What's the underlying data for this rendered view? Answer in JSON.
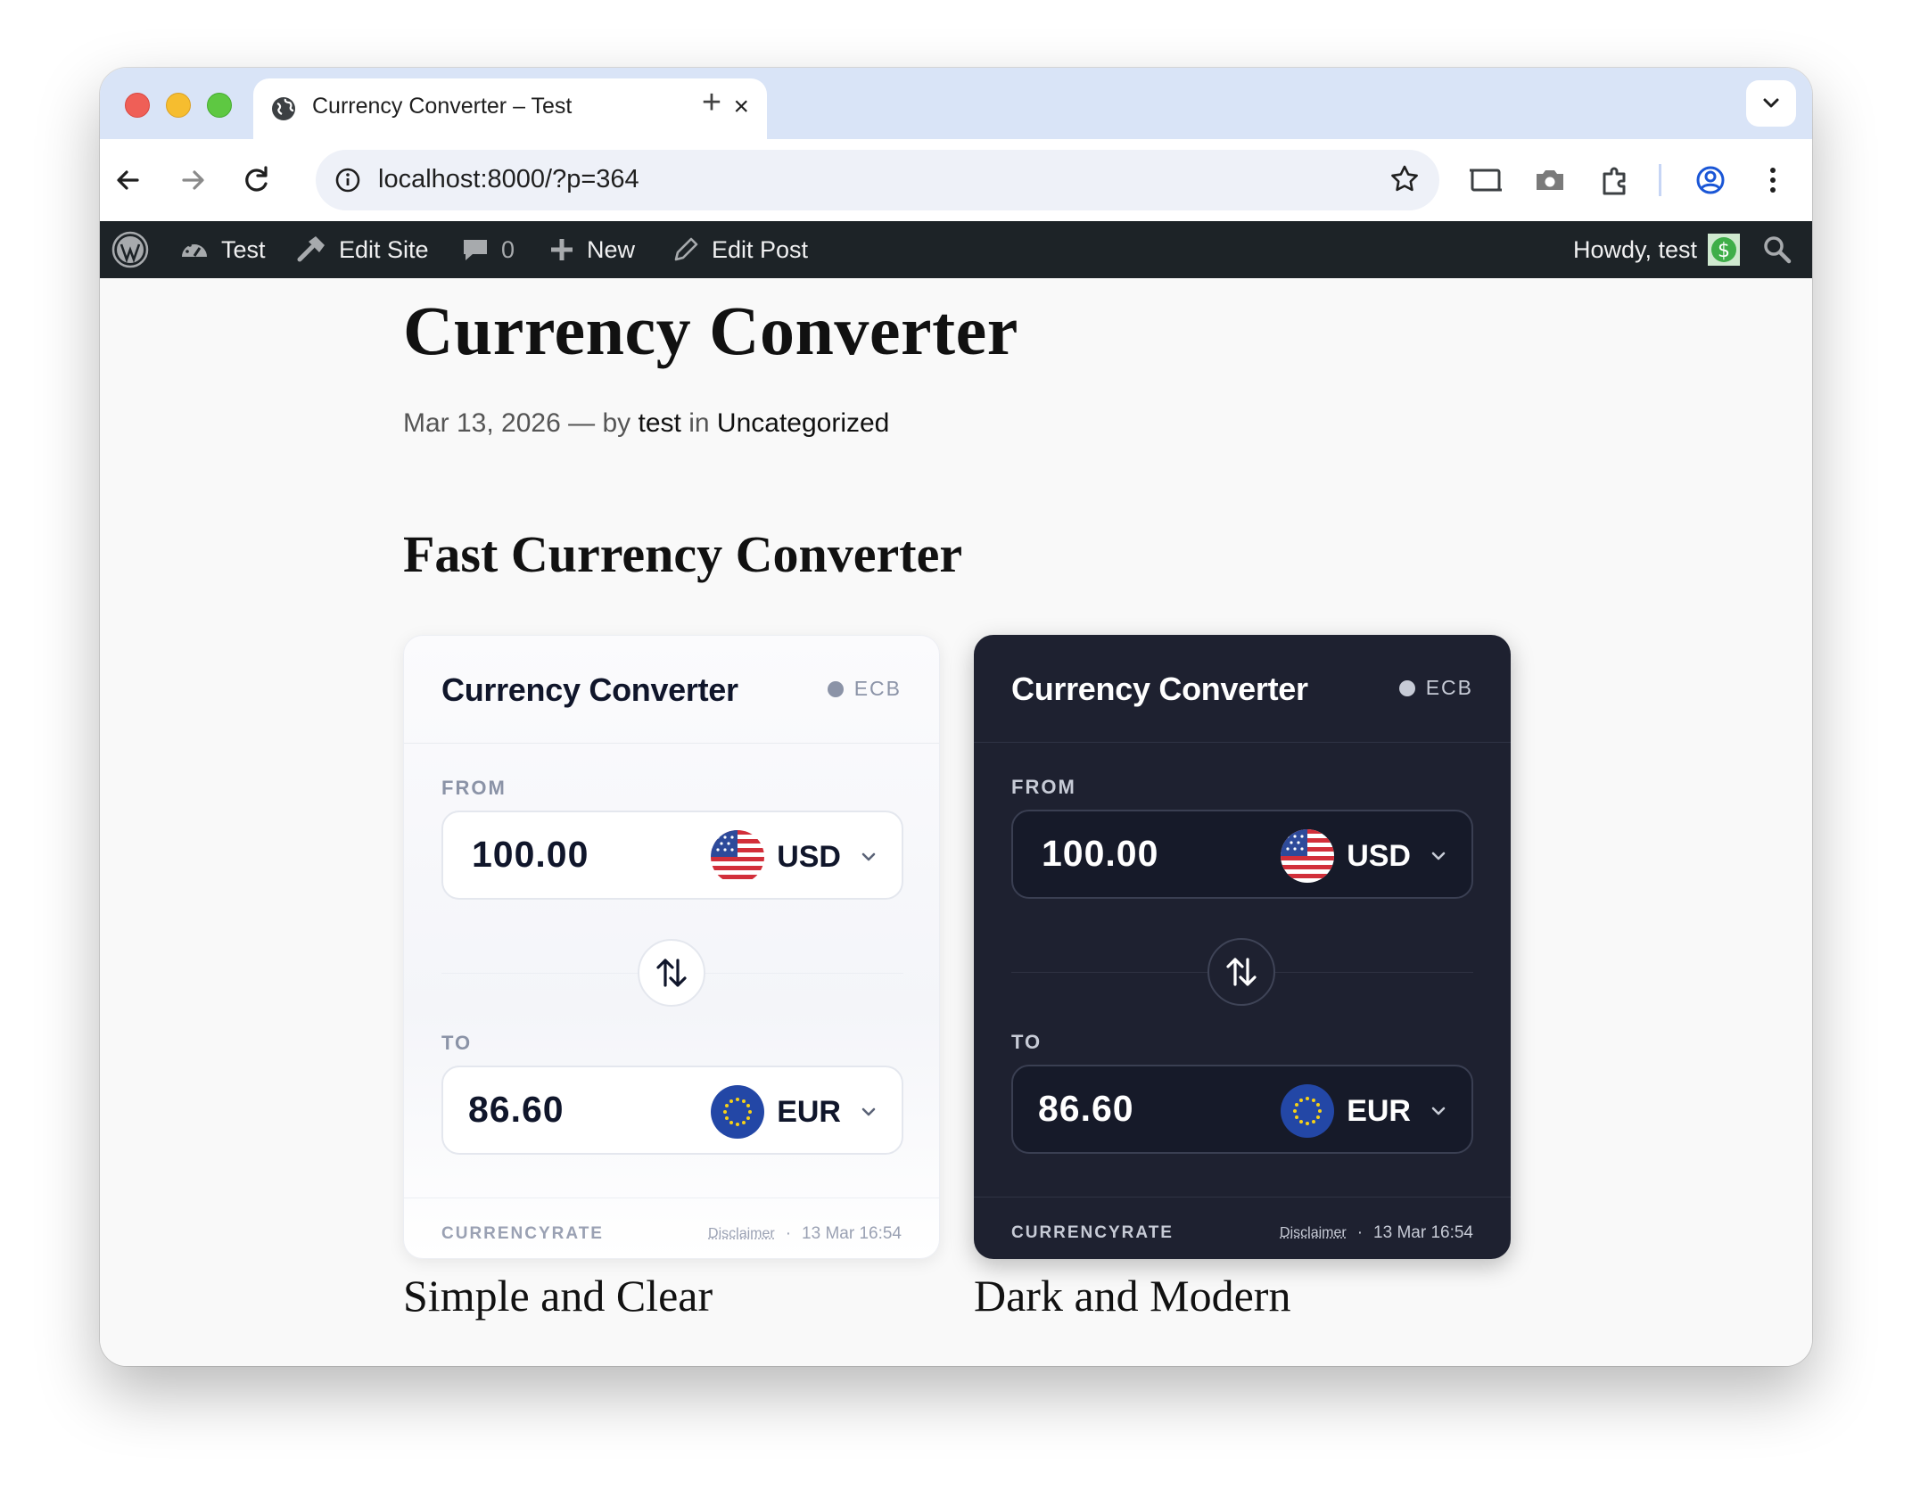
{
  "browser": {
    "tab_title": "Currency Converter – Test",
    "tab_close": "×",
    "new_tab": "+",
    "url": "localhost:8000/?p=364"
  },
  "adminbar": {
    "site_name": "Test",
    "edit_site": "Edit Site",
    "comments_count": "0",
    "new_label": "New",
    "edit_post": "Edit Post",
    "howdy": "Howdy, test"
  },
  "post": {
    "title": "Currency Converter",
    "date": "Mar 13, 2026",
    "dash": "—",
    "by": "by",
    "author": "test",
    "in": "in",
    "category": "Uncategorized",
    "heading": "Fast Currency Converter",
    "caption_light": "Simple and Clear",
    "caption_dark": "Dark and Modern"
  },
  "widgets": {
    "light": {
      "title": "Currency Converter",
      "source": "ECB",
      "from_label": "FROM",
      "from_amount": "100.00",
      "from_code": "USD",
      "to_label": "TO",
      "to_amount": "86.60",
      "to_code": "EUR",
      "brand": "CURRENCYRATE",
      "disclaimer": "Disclaimer",
      "sep": "·",
      "updated": "13 Mar 16:54"
    },
    "dark": {
      "title": "Currency Converter",
      "source": "ECB",
      "from_label": "FROM",
      "from_amount": "100.00",
      "from_code": "USD",
      "to_label": "TO",
      "to_amount": "86.60",
      "to_code": "EUR",
      "brand": "CURRENCYRATE",
      "disclaimer": "Disclaimer",
      "sep": "·",
      "updated": "13 Mar 16:54"
    }
  },
  "colors": {
    "admin_bar": "#1d2327",
    "dark_widget": "#1e2130",
    "tab_strip": "#d9e4f7"
  }
}
